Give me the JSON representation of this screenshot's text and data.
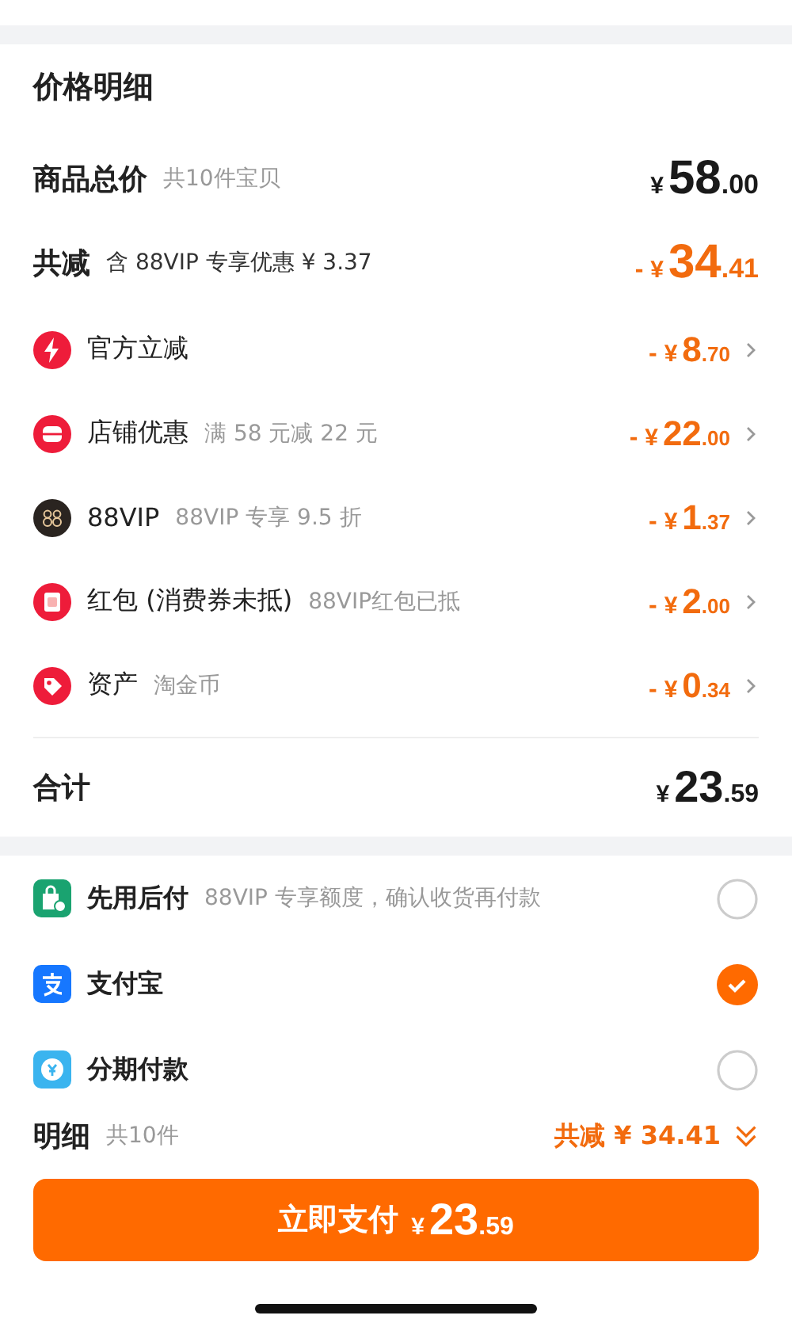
{
  "title": "价格明细",
  "subtotal": {
    "label": "商品总价",
    "note": "共10件宝贝",
    "price": {
      "currency": "¥",
      "int": "58",
      "dec": ".00"
    }
  },
  "reduction": {
    "label": "共减",
    "note": "含 88VIP 专享优惠 ¥ 3.37",
    "price": {
      "sign": "- ",
      "currency": "¥",
      "int": "34",
      "dec": ".41"
    }
  },
  "discounts": [
    {
      "kind": "bolt",
      "label": "官方立减",
      "price": {
        "sign": "- ",
        "currency": "¥",
        "int": "8",
        "dec": ".70"
      }
    },
    {
      "kind": "store",
      "label": "店铺优惠",
      "note": "满 58 元减 22 元",
      "price": {
        "sign": "- ",
        "currency": "¥",
        "int": "22",
        "dec": ".00"
      }
    },
    {
      "kind": "vip",
      "label": "88VIP",
      "note": "88VIP 专享 9.5 折",
      "price": {
        "sign": "- ",
        "currency": "¥",
        "int": "1",
        "dec": ".37"
      }
    },
    {
      "kind": "redpacket",
      "label": "红包 (消费券未抵)",
      "note": "88VIP红包已抵",
      "price": {
        "sign": "- ",
        "currency": "¥",
        "int": "2",
        "dec": ".00"
      }
    },
    {
      "kind": "tag",
      "label": "资产",
      "note": "淘金币",
      "price": {
        "sign": "- ",
        "currency": "¥",
        "int": "0",
        "dec": ".34"
      }
    }
  ],
  "total": {
    "label": "合计",
    "price": {
      "currency": "¥",
      "int": "23",
      "dec": ".59"
    }
  },
  "payments": [
    {
      "kind": "bag",
      "label": "先用后付",
      "note": "88VIP 专享额度，确认收货再付款",
      "selected": false
    },
    {
      "kind": "alipay",
      "label": "支付宝",
      "selected": true
    },
    {
      "kind": "installment",
      "label": "分期付款",
      "selected": false
    }
  ],
  "summary": {
    "label": "明细",
    "count": "共10件",
    "saving": "共减 ¥ 34.41"
  },
  "pay_button": {
    "label": "立即支付",
    "price": {
      "currency": "¥",
      "int": "23",
      "dec": ".59"
    }
  }
}
